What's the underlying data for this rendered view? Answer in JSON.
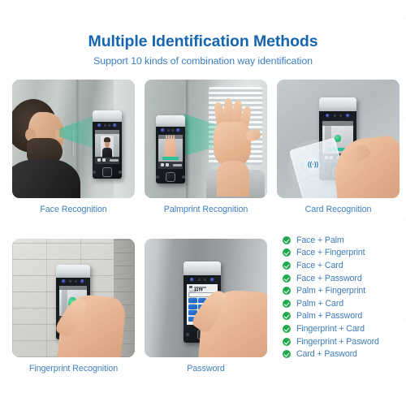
{
  "header": {
    "title": "Multiple Identification Methods",
    "subtitle": "Support 10 kinds of combination way identification",
    "title_color": "#1565b0",
    "subtitle_color": "#3b7fc4"
  },
  "panels": [
    {
      "caption": "Face Recognition",
      "icon": "face-scan-icon",
      "beam_color": "#2ebe96"
    },
    {
      "caption": "Palmprint Recognition",
      "icon": "palm-scan-icon",
      "beam_color": "#2ebe96"
    },
    {
      "caption": "Card Recognition",
      "icon": "rfid-card-icon",
      "beam_color": "#6eafeb"
    },
    {
      "caption": "Fingerprint Recognition",
      "icon": "fingerprint-touch-icon",
      "beam_color": "#22b36f"
    },
    {
      "caption": "Password",
      "icon": "keypad-icon",
      "beam_color": "#2f7fe0"
    }
  ],
  "combinations": {
    "check_color": "#21a84c",
    "text_color": "#3d7ab8",
    "items": [
      "Face + Palm",
      "Face + Fingerprint",
      "Face + Card",
      "Face + Password",
      "Palm + Fingerprint",
      "Palm + Card",
      "Palm + Password",
      "Fingerprint + Card",
      "Fingerprint + Pasword",
      "Card + Pasword"
    ]
  },
  "device": {
    "rfid_glyph": "((·))"
  }
}
